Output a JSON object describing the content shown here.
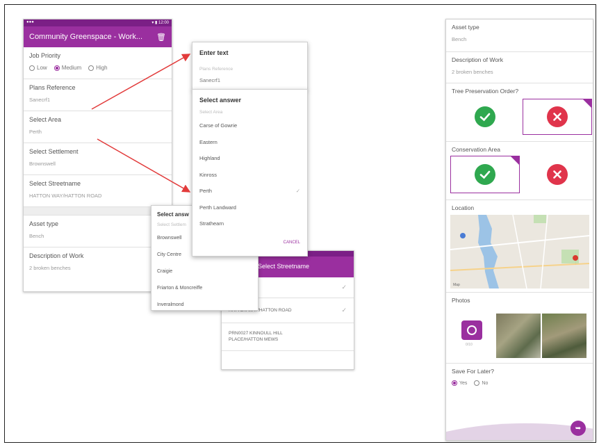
{
  "left_screen": {
    "app_title": "Community Greenspace - Work...",
    "fields": {
      "job_priority": {
        "label": "Job Priority",
        "options": [
          "Low",
          "Medium",
          "High"
        ],
        "selected": "Medium"
      },
      "plans_reference": {
        "label": "Plans Reference",
        "value": "Sanecrf1"
      },
      "select_area": {
        "label": "Select Area",
        "value": "Perth"
      },
      "select_settlement": {
        "label": "Select Settlement",
        "value": "Brownswell"
      },
      "select_streetname": {
        "label": "Select Streetname",
        "value": "HATTON WAY/HATTON ROAD"
      },
      "asset_type": {
        "label": "Asset type",
        "value": "Bench"
      },
      "description_of_work": {
        "label": "Description of Work",
        "value": "2 broken benches"
      }
    }
  },
  "enter_text_dialog": {
    "title": "Enter text",
    "hint": "Plans Reference",
    "value": "Sanecrf1"
  },
  "select_area_dialog": {
    "title": "Select answer",
    "hint": "Select Area",
    "options": [
      "Carse of Gowrie",
      "Eastern",
      "Highland",
      "Kinross",
      "Perth",
      "Perth Landward",
      "Strathearn"
    ],
    "selected": "Perth",
    "action": "CANCEL"
  },
  "select_settlement_dialog": {
    "title": "Select answ",
    "hint": "Select Settlem",
    "options": [
      "Brownswell",
      "City Centre",
      "Craigie",
      "Friarton & Moncreiffe",
      "Inveralmond"
    ]
  },
  "streetname_screen": {
    "header": "Select Streetname",
    "rows": [
      {
        "text": "",
        "checked": true
      },
      {
        "text": "HATTON WAY/HATTON ROAD",
        "checked": true
      },
      {
        "text": "PRN0027 KINNOULL HILL PLACE/HATTON MEWS",
        "checked": false
      }
    ]
  },
  "right_screen": {
    "asset_type": {
      "label": "Asset type",
      "value": "Bench"
    },
    "description_of_work": {
      "label": "Description of Work",
      "value": "2 broken benches"
    },
    "tree_preservation_order": {
      "label": "Tree Preservation Order?",
      "selected": "no"
    },
    "conservation_area": {
      "label": "Conservation Area",
      "selected": "yes"
    },
    "location": {
      "label": "Location",
      "map_brand": "Map"
    },
    "photos": {
      "label": "Photos",
      "camera_caption": "0/10"
    },
    "save_for_later": {
      "label": "Save For Later?",
      "options": [
        "Yes",
        "No"
      ],
      "selected": "Yes"
    }
  },
  "colors": {
    "accent": "#9a2f9f",
    "accent_dark": "#7b1f86",
    "yes_green": "#2fa84f",
    "no_red": "#e0344b",
    "arrow_red": "#e23b3b"
  }
}
